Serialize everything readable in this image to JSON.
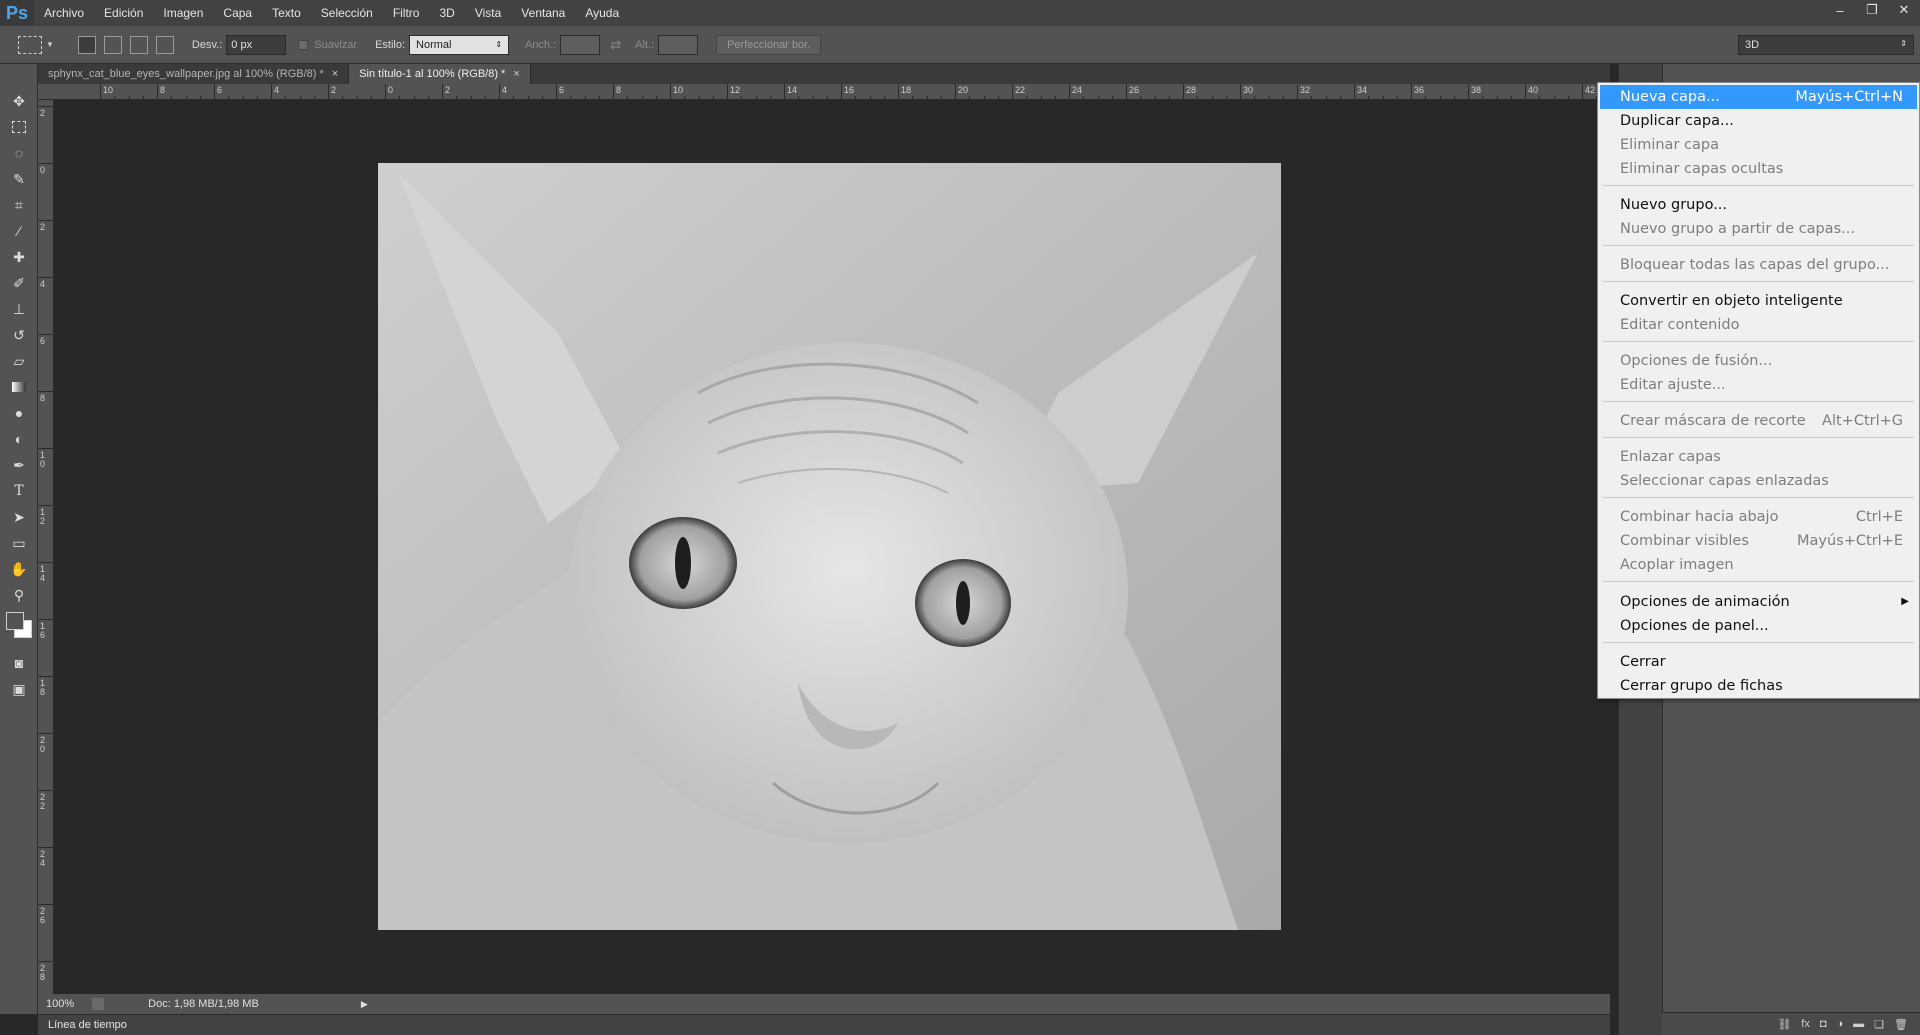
{
  "app": {
    "logo": "Ps",
    "menu": [
      "Archivo",
      "Edición",
      "Imagen",
      "Capa",
      "Texto",
      "Selección",
      "Filtro",
      "3D",
      "Vista",
      "Ventana",
      "Ayuda"
    ],
    "window_controls": [
      "–",
      "❐",
      "✕"
    ]
  },
  "options": {
    "feather_label": "Desv.:",
    "feather_value": "0 px",
    "antialias_label": "Suavizar",
    "style_label": "Estilo:",
    "style_value": "Normal",
    "width_label": "Anch.:",
    "height_label": "Alt.:",
    "refine_button": "Perfeccionar bor.",
    "workspace": "3D"
  },
  "tabs": [
    {
      "label": "sphynx_cat_blue_eyes_wallpaper.jpg al 100% (RGB/8) *",
      "active": false
    },
    {
      "label": "Sin título-1 al 100% (RGB/8) *",
      "active": true
    }
  ],
  "ruler": {
    "h_labels": [
      "10",
      "8",
      "6",
      "4",
      "2",
      "0",
      "2",
      "4",
      "6",
      "8",
      "10",
      "12",
      "14",
      "16",
      "18",
      "20",
      "22",
      "24",
      "26",
      "28",
      "30",
      "32",
      "34",
      "36",
      "38",
      "40",
      "42"
    ],
    "v_labels": [
      "2",
      "0",
      "2",
      "4",
      "6",
      "8",
      "10",
      "12",
      "14",
      "16",
      "18",
      "20",
      "22",
      "24",
      "26",
      "28"
    ]
  },
  "status": {
    "zoom": "100%",
    "doc": "Doc: 1,98 MB/1,98 MB"
  },
  "timeline_label": "Línea de tiempo",
  "flyout": {
    "items": [
      {
        "label": "Nueva capa...",
        "shortcut": "Mayús+Ctrl+N",
        "state": "highlighted"
      },
      {
        "label": "Duplicar capa...",
        "shortcut": "",
        "state": "enabled"
      },
      {
        "label": "Eliminar capa",
        "shortcut": "",
        "state": "disabled"
      },
      {
        "label": "Eliminar capas ocultas",
        "shortcut": "",
        "state": "disabled"
      },
      {
        "label": "Nuevo grupo...",
        "shortcut": "",
        "state": "enabled"
      },
      {
        "label": "Nuevo grupo a partir de capas...",
        "shortcut": "",
        "state": "disabled"
      },
      {
        "label": "Bloquear todas las capas del grupo...",
        "shortcut": "",
        "state": "disabled"
      },
      {
        "label": "Convertir en objeto inteligente",
        "shortcut": "",
        "state": "enabled"
      },
      {
        "label": "Editar contenido",
        "shortcut": "",
        "state": "disabled"
      },
      {
        "label": "Opciones de fusión...",
        "shortcut": "",
        "state": "disabled"
      },
      {
        "label": "Editar ajuste...",
        "shortcut": "",
        "state": "disabled"
      },
      {
        "label": "Crear máscara de recorte",
        "shortcut": "Alt+Ctrl+G",
        "state": "disabled"
      },
      {
        "label": "Enlazar capas",
        "shortcut": "",
        "state": "disabled"
      },
      {
        "label": "Seleccionar capas enlazadas",
        "shortcut": "",
        "state": "disabled"
      },
      {
        "label": "Combinar hacia abajo",
        "shortcut": "Ctrl+E",
        "state": "disabled"
      },
      {
        "label": "Combinar visibles",
        "shortcut": "Mayús+Ctrl+E",
        "state": "disabled"
      },
      {
        "label": "Acoplar imagen",
        "shortcut": "",
        "state": "disabled"
      },
      {
        "label": "Opciones de animación",
        "shortcut": "",
        "state": "submenu"
      },
      {
        "label": "Opciones de panel...",
        "shortcut": "",
        "state": "enabled"
      },
      {
        "label": "Cerrar",
        "shortcut": "",
        "state": "enabled"
      },
      {
        "label": "Cerrar grupo de fichas",
        "shortcut": "",
        "state": "enabled"
      }
    ]
  },
  "colors": {
    "menubar": "#424242",
    "panel": "#535353",
    "canvas_bg": "#282828",
    "highlight": "#3399ff",
    "logo": "#4ea6ea"
  }
}
